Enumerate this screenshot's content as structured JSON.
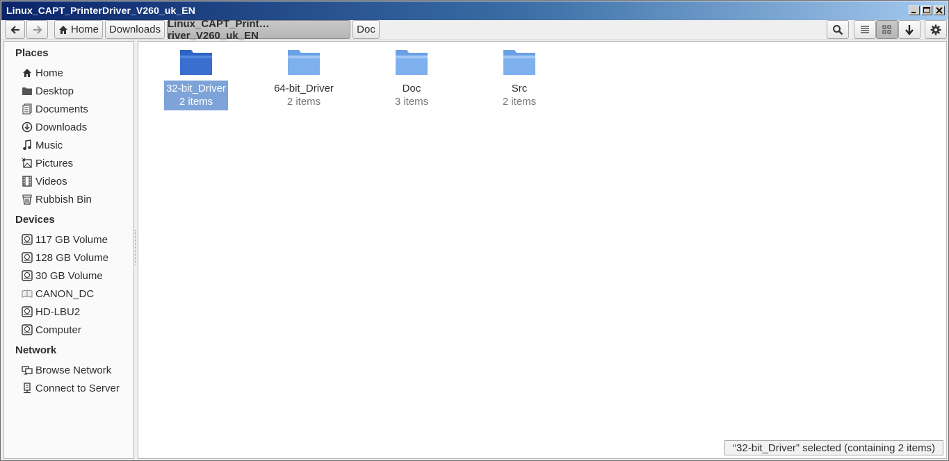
{
  "window": {
    "title": "Linux_CAPT_PrinterDriver_V260_uk_EN"
  },
  "toolbar": {
    "back_icon": "arrow-left-icon",
    "forward_icon": "arrow-right-icon",
    "breadcrumbs": [
      {
        "label": "Home",
        "icon": "home-icon"
      },
      {
        "label": "Downloads"
      },
      {
        "label": "Linux_CAPT_Print…river_V260_uk_EN",
        "active": true
      },
      {
        "label": "Doc"
      }
    ],
    "right_icons": [
      "search-icon",
      "list-view-icon",
      "grid-view-icon",
      "download-icon",
      "gear-icon"
    ]
  },
  "sidebar": {
    "places_title": "Places",
    "places": [
      {
        "label": "Home",
        "icon": "home-icon"
      },
      {
        "label": "Desktop",
        "icon": "folder-icon"
      },
      {
        "label": "Documents",
        "icon": "document-icon"
      },
      {
        "label": "Downloads",
        "icon": "download-circle-icon"
      },
      {
        "label": "Music",
        "icon": "music-note-icon"
      },
      {
        "label": "Pictures",
        "icon": "picture-icon"
      },
      {
        "label": "Videos",
        "icon": "film-icon"
      },
      {
        "label": "Rubbish Bin",
        "icon": "trash-icon"
      }
    ],
    "devices_title": "Devices",
    "devices": [
      {
        "label": "117 GB Volume",
        "icon": "drive-icon"
      },
      {
        "label": "128 GB Volume",
        "icon": "drive-icon"
      },
      {
        "label": "30 GB Volume",
        "icon": "drive-icon"
      },
      {
        "label": "CANON_DC",
        "icon": "optical-disc-icon"
      },
      {
        "label": "HD-LBU2",
        "icon": "drive-icon"
      },
      {
        "label": "Computer",
        "icon": "drive-icon"
      }
    ],
    "network_title": "Network",
    "network": [
      {
        "label": "Browse Network",
        "icon": "network-icon"
      },
      {
        "label": "Connect to Server",
        "icon": "server-icon"
      }
    ]
  },
  "files": [
    {
      "name": "32-bit_Driver",
      "count": "2 items",
      "selected": true
    },
    {
      "name": "64-bit_Driver",
      "count": "2 items"
    },
    {
      "name": "Doc",
      "count": "3 items"
    },
    {
      "name": "Src",
      "count": "2 items"
    }
  ],
  "status": {
    "text": "“32-bit_Driver” selected (containing 2 items)"
  },
  "colors": {
    "titlebar_start": "#0a246a",
    "titlebar_end": "#a6caf0",
    "selection": "#7ea3d8",
    "folder_selected": "#3a6fcf",
    "folder_normal": "#7fb0ee"
  }
}
